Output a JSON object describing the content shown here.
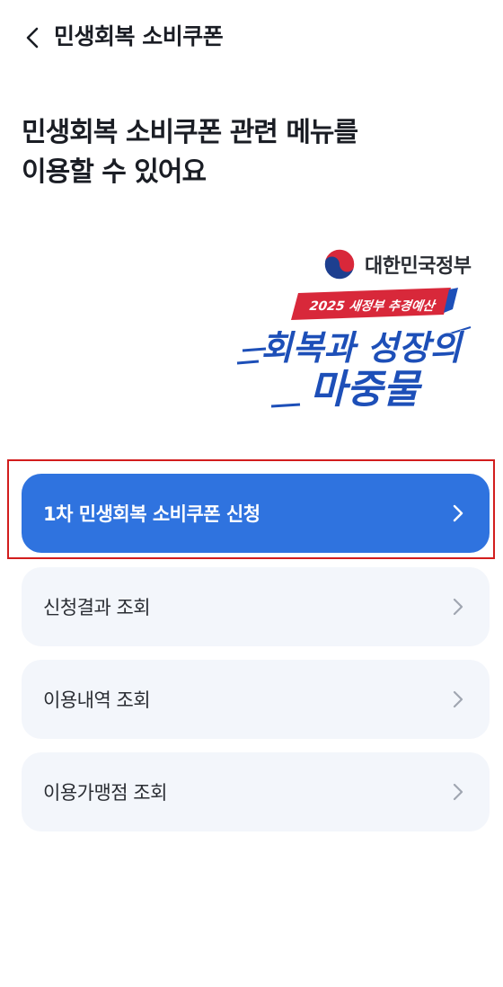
{
  "header": {
    "title": "민생회복 소비쿠폰",
    "back_icon": "chevron-left-icon"
  },
  "headline": {
    "line1": "민생회복 소비쿠폰 관련 메뉴를",
    "line2": "이용할 수 있어요"
  },
  "banner": {
    "gov_name": "대한민국정부",
    "ribbon_text": "2025 새정부 추경예산",
    "slogan_line1": "회복과 성장의",
    "slogan_line2": "마중물",
    "colors": {
      "ribbon": "#d8283a",
      "slogan": "#1d4fb8",
      "emblem_red": "#d8283a",
      "emblem_blue": "#1d3f8f"
    }
  },
  "menu": {
    "items": [
      {
        "label": "1차 민생회복 소비쿠폰 신청",
        "primary": true,
        "icon": "chevron-right-icon"
      },
      {
        "label": "신청결과 조회",
        "primary": false,
        "icon": "chevron-right-icon"
      },
      {
        "label": "이용내역 조회",
        "primary": false,
        "icon": "chevron-right-icon"
      },
      {
        "label": "이용가맹점 조회",
        "primary": false,
        "icon": "chevron-right-icon"
      }
    ]
  },
  "colors": {
    "primary": "#2f73df",
    "menu_bg": "#f3f6fb",
    "highlight": "#d21d1d"
  }
}
